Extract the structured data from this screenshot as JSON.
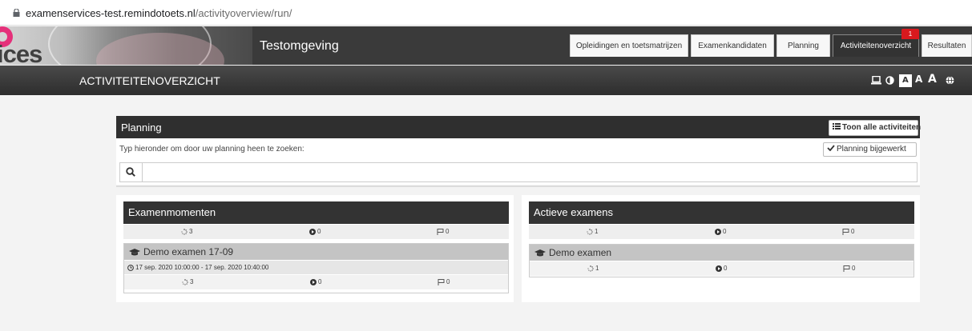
{
  "browser": {
    "url_host": "examenservices-test.remindotoets.nl",
    "url_path": "/activityoverview/run/"
  },
  "header": {
    "logo_text": "ices",
    "environment": "Testomgeving",
    "tabs": [
      {
        "label": "Opleidingen en toetsmatrijzen"
      },
      {
        "label": "Examenkandidaten"
      },
      {
        "label": "Planning"
      },
      {
        "label": "Activiteitenoverzicht",
        "active": true,
        "badge": "1"
      },
      {
        "label": "Resultaten"
      }
    ]
  },
  "titlebar": {
    "title": "ACTIVITEITENOVERZICHT",
    "tools": [
      {
        "icon": "laptop-icon"
      },
      {
        "icon": "contrast-icon"
      },
      {
        "icon": "font-size-small-icon",
        "glyph": "A"
      },
      {
        "icon": "font-size-medium-icon",
        "glyph": "A"
      },
      {
        "icon": "font-size-large-icon",
        "glyph": "A"
      },
      {
        "icon": "globe-icon"
      }
    ]
  },
  "planning": {
    "title": "Planning",
    "show_all_label": "Toon alle activiteiten",
    "hint": "Typ hieronder om door uw planning heen te zoeken:",
    "updated_label": "Planning bijgewerkt",
    "search_value": ""
  },
  "exam_moments": {
    "title": "Examenmomenten",
    "totals": {
      "pending": "3",
      "active": "0",
      "finished": "0"
    },
    "items": [
      {
        "name": "Demo examen 17-09",
        "time": "17 sep. 2020 10:00:00 - 17 sep. 2020 10:40:00",
        "pending": "3",
        "active": "0",
        "finished": "0"
      }
    ]
  },
  "active_exams": {
    "title": "Actieve examens",
    "totals": {
      "pending": "1",
      "active": "0",
      "finished": "0"
    },
    "items": [
      {
        "name": "Demo examen",
        "pending": "1",
        "active": "0",
        "finished": "0"
      }
    ]
  },
  "colors": {
    "header": "#3a3a3a",
    "accent_pink": "#e5307a",
    "badge_red": "#d9191e"
  }
}
